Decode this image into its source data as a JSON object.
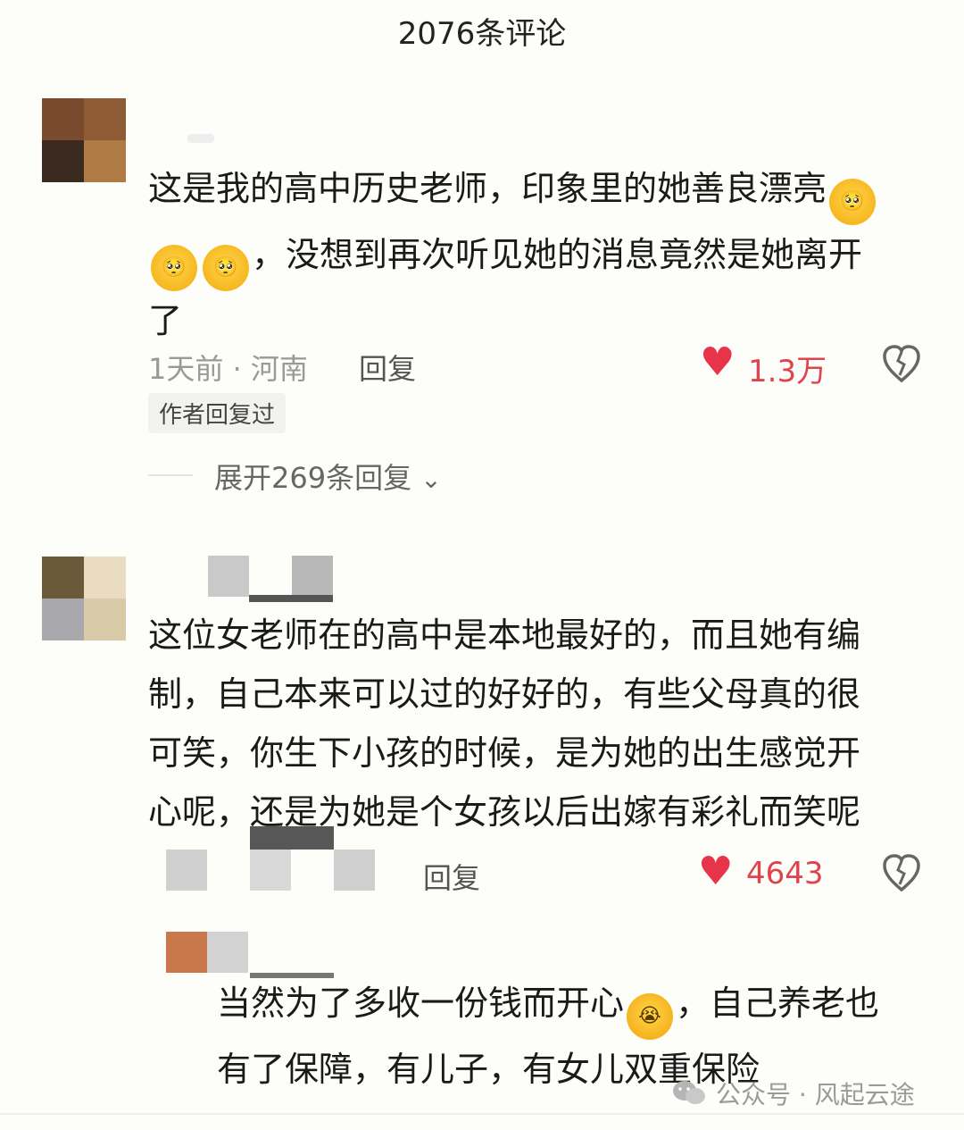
{
  "header": {
    "title": "2076条评论"
  },
  "comments": [
    {
      "text_line1": "这是我的高中历史老师，印象里的她善良漂亮",
      "text_line2": "，没想到再次听见她的消息竟然是她离开",
      "text_line3": "了",
      "meta": "1天前 · 河南",
      "reply_label": "回复",
      "likes": "1.3万",
      "author_tag": "作者回复过",
      "expand_label": "展开269条回复"
    },
    {
      "text_lines": [
        "这位女老师在的高中是本地最好的，而且她有编",
        "制，自己本来可以过的好好的，有些父母真的很",
        "可笑，你生下小孩的时候，是为她的出生感觉开",
        "心呢，还是为她是个女孩以后出嫁有彩礼而笑呢"
      ],
      "reply_label": "回复",
      "likes": "4643"
    }
  ],
  "reply": {
    "text_line1a": "当然为了多收一份钱而开心",
    "text_line1b": "，自己养老也",
    "text_line2": "有了保障，有儿子，有女儿双重保险"
  },
  "watermark": {
    "text": "公众号 · 风起云途"
  },
  "icons": {
    "heart": "heart-icon",
    "broken_heart": "broken-heart-icon",
    "chevron": "chevron-down-icon",
    "emoji_pleading": "pleading-face-emoji",
    "emoji_crying": "crying-face-emoji",
    "wechat": "wechat-icon"
  },
  "colors": {
    "like_red": "#e8344a",
    "meta_gray": "#999999"
  }
}
